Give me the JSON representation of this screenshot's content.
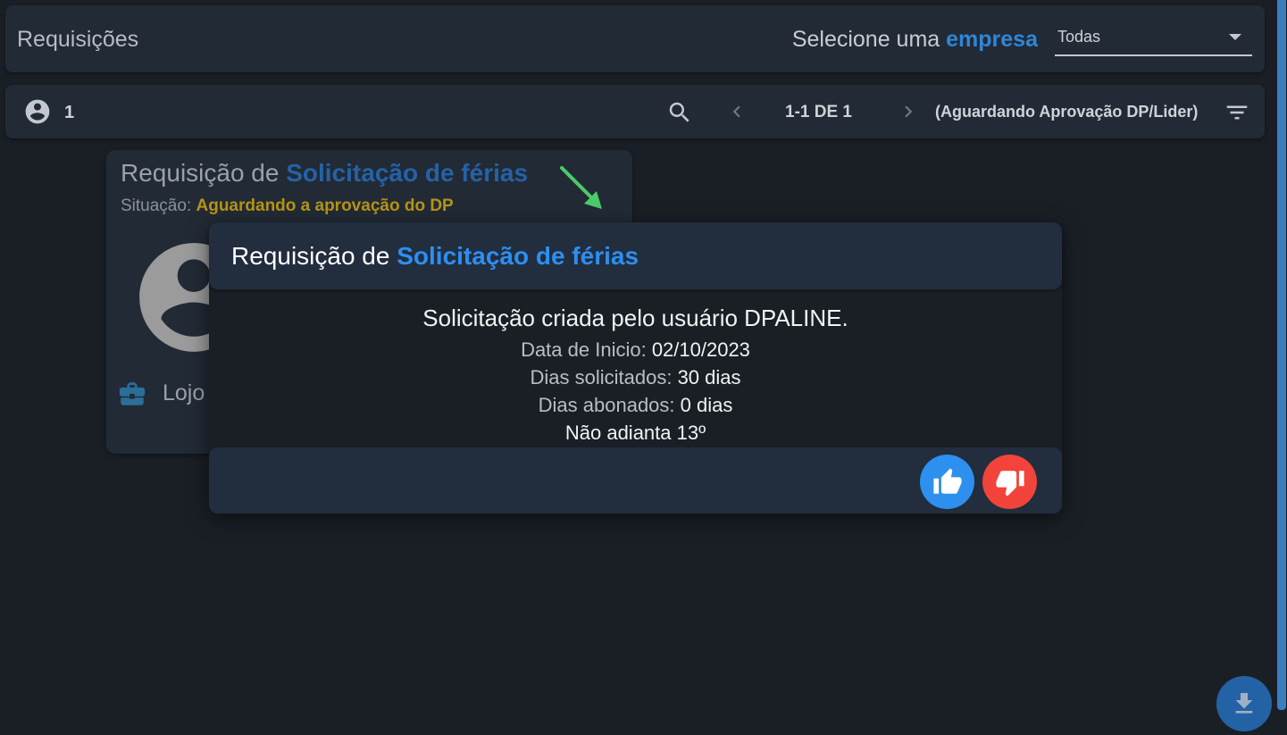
{
  "header": {
    "title": "Requisições",
    "company_prefix": "Selecione uma ",
    "company_highlight": "empresa",
    "company_select_value": "Todas"
  },
  "toolbar": {
    "user_count": "1",
    "range": "1-1 DE 1",
    "status_filter": "(Aguardando Aprovação DP/Lider)"
  },
  "card": {
    "title_prefix": "Requisição de ",
    "title_highlight": "Solicitação de férias",
    "status_label": "Situação: ",
    "status_value": "Aguardando a aprovação do DP",
    "company_name": "Lojo"
  },
  "modal": {
    "title_prefix": "Requisição de ",
    "title_highlight": "Solicitação de férias",
    "created_by": "Solicitação criada pelo usuário DPALINE.",
    "start_label": "Data de Inicio: ",
    "start_value": "02/10/2023",
    "days_requested_label": "Dias solicitados: ",
    "days_requested_value": "30 dias",
    "days_paid_label": "Dias abonados: ",
    "days_paid_value": "0 dias",
    "advance_13": "Não adianta 13º"
  },
  "icons": {
    "user": "account-circle-icon",
    "search": "search-icon",
    "prev": "chevron-left-icon",
    "next": "chevron-right-icon",
    "filter": "filter-list-icon",
    "briefcase": "briefcase-icon",
    "arrow": "arrow-down-right-icon",
    "approve": "thumb-up-icon",
    "reject": "thumb-down-icon",
    "download": "download-icon"
  },
  "colors": {
    "accent": "#2c8ff1",
    "approve": "#2d90ee",
    "reject": "#f2443a",
    "status": "#b59516",
    "arrow": "#4cc96a"
  }
}
